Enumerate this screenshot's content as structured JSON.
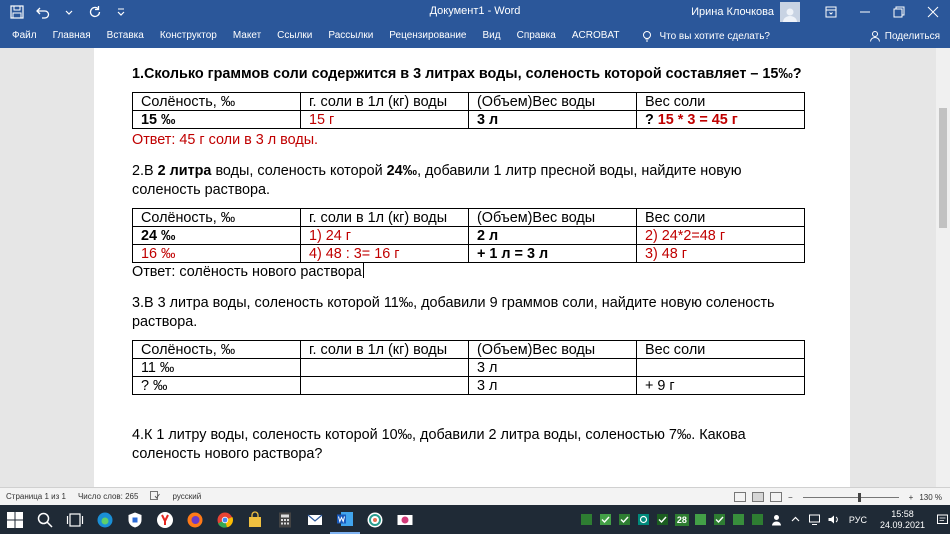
{
  "window": {
    "title": "Документ1  -  Word",
    "user": "Ирина Клочкова"
  },
  "ribbon": {
    "tabs": [
      "Файл",
      "Главная",
      "Вставка",
      "Конструктор",
      "Макет",
      "Ссылки",
      "Рассылки",
      "Рецензирование",
      "Вид",
      "Справка",
      "ACROBAT"
    ],
    "tell_me": "Что вы хотите сделать?",
    "share": "Поделиться"
  },
  "document": {
    "q1": {
      "text": "1.Сколько граммов соли содержится в 3 литрах воды, соленость которой составляет – 15‰?",
      "table": [
        [
          "Солёность, ‰",
          "г. соли в 1л (кг) воды",
          "(Объем)Вес воды",
          "Вес соли"
        ],
        [
          "15 ‰",
          "15 г",
          "3 л",
          "? ",
          "15 * 3 = 45 г"
        ]
      ],
      "answer": "Ответ: 45 г соли в 3 л воды."
    },
    "q2": {
      "p1": "2.В ",
      "p2": "2 литра",
      "p3": " воды, соленость которой ",
      "p4": "24‰",
      "p5": ", добавили 1 литр пресной воды, найдите новую соленость раствора.",
      "table": [
        [
          "Солёность, ‰",
          "г. соли в 1л (кг) воды",
          "(Объем)Вес воды",
          "Вес соли"
        ],
        [
          "24 ‰",
          "1) 24 г",
          "2 л",
          "2) 24*2=48 г"
        ],
        [
          "16 ‰",
          "4) 48 : 3= 16 г",
          "+ 1 л = 3 л",
          "3) 48 г"
        ]
      ],
      "answer": "Ответ: солёность нового раствора"
    },
    "q3": {
      "text": "3.В 3 литра воды, соленость которой 11‰, добавили 9 граммов соли, найдите новую соленость раствора.",
      "table": [
        [
          "Солёность, ‰",
          "г. соли в 1л (кг) воды",
          "(Объем)Вес воды",
          "Вес соли"
        ],
        [
          "11 ‰",
          "",
          "3 л",
          ""
        ],
        [
          "? ‰",
          "",
          "3 л",
          "+ 9 г"
        ]
      ]
    },
    "q4": {
      "text": "4.К 1 литру воды, соленость которой 10‰, добавили 2 литра воды, соленостью 7‰. Какова соленость нового раствора?"
    }
  },
  "status": {
    "page": "Страница 1 из 1",
    "words": "Число слов: 265",
    "language": "русский",
    "zoom": "130 %",
    "zoom_fraction": 0.6
  },
  "taskbar": {
    "lang": "РУС",
    "time": "15:58",
    "date": "24.09.2021",
    "calendar_badge": "28"
  },
  "colors": {
    "word_blue": "#2b579a",
    "answer_red": "#c00000"
  }
}
